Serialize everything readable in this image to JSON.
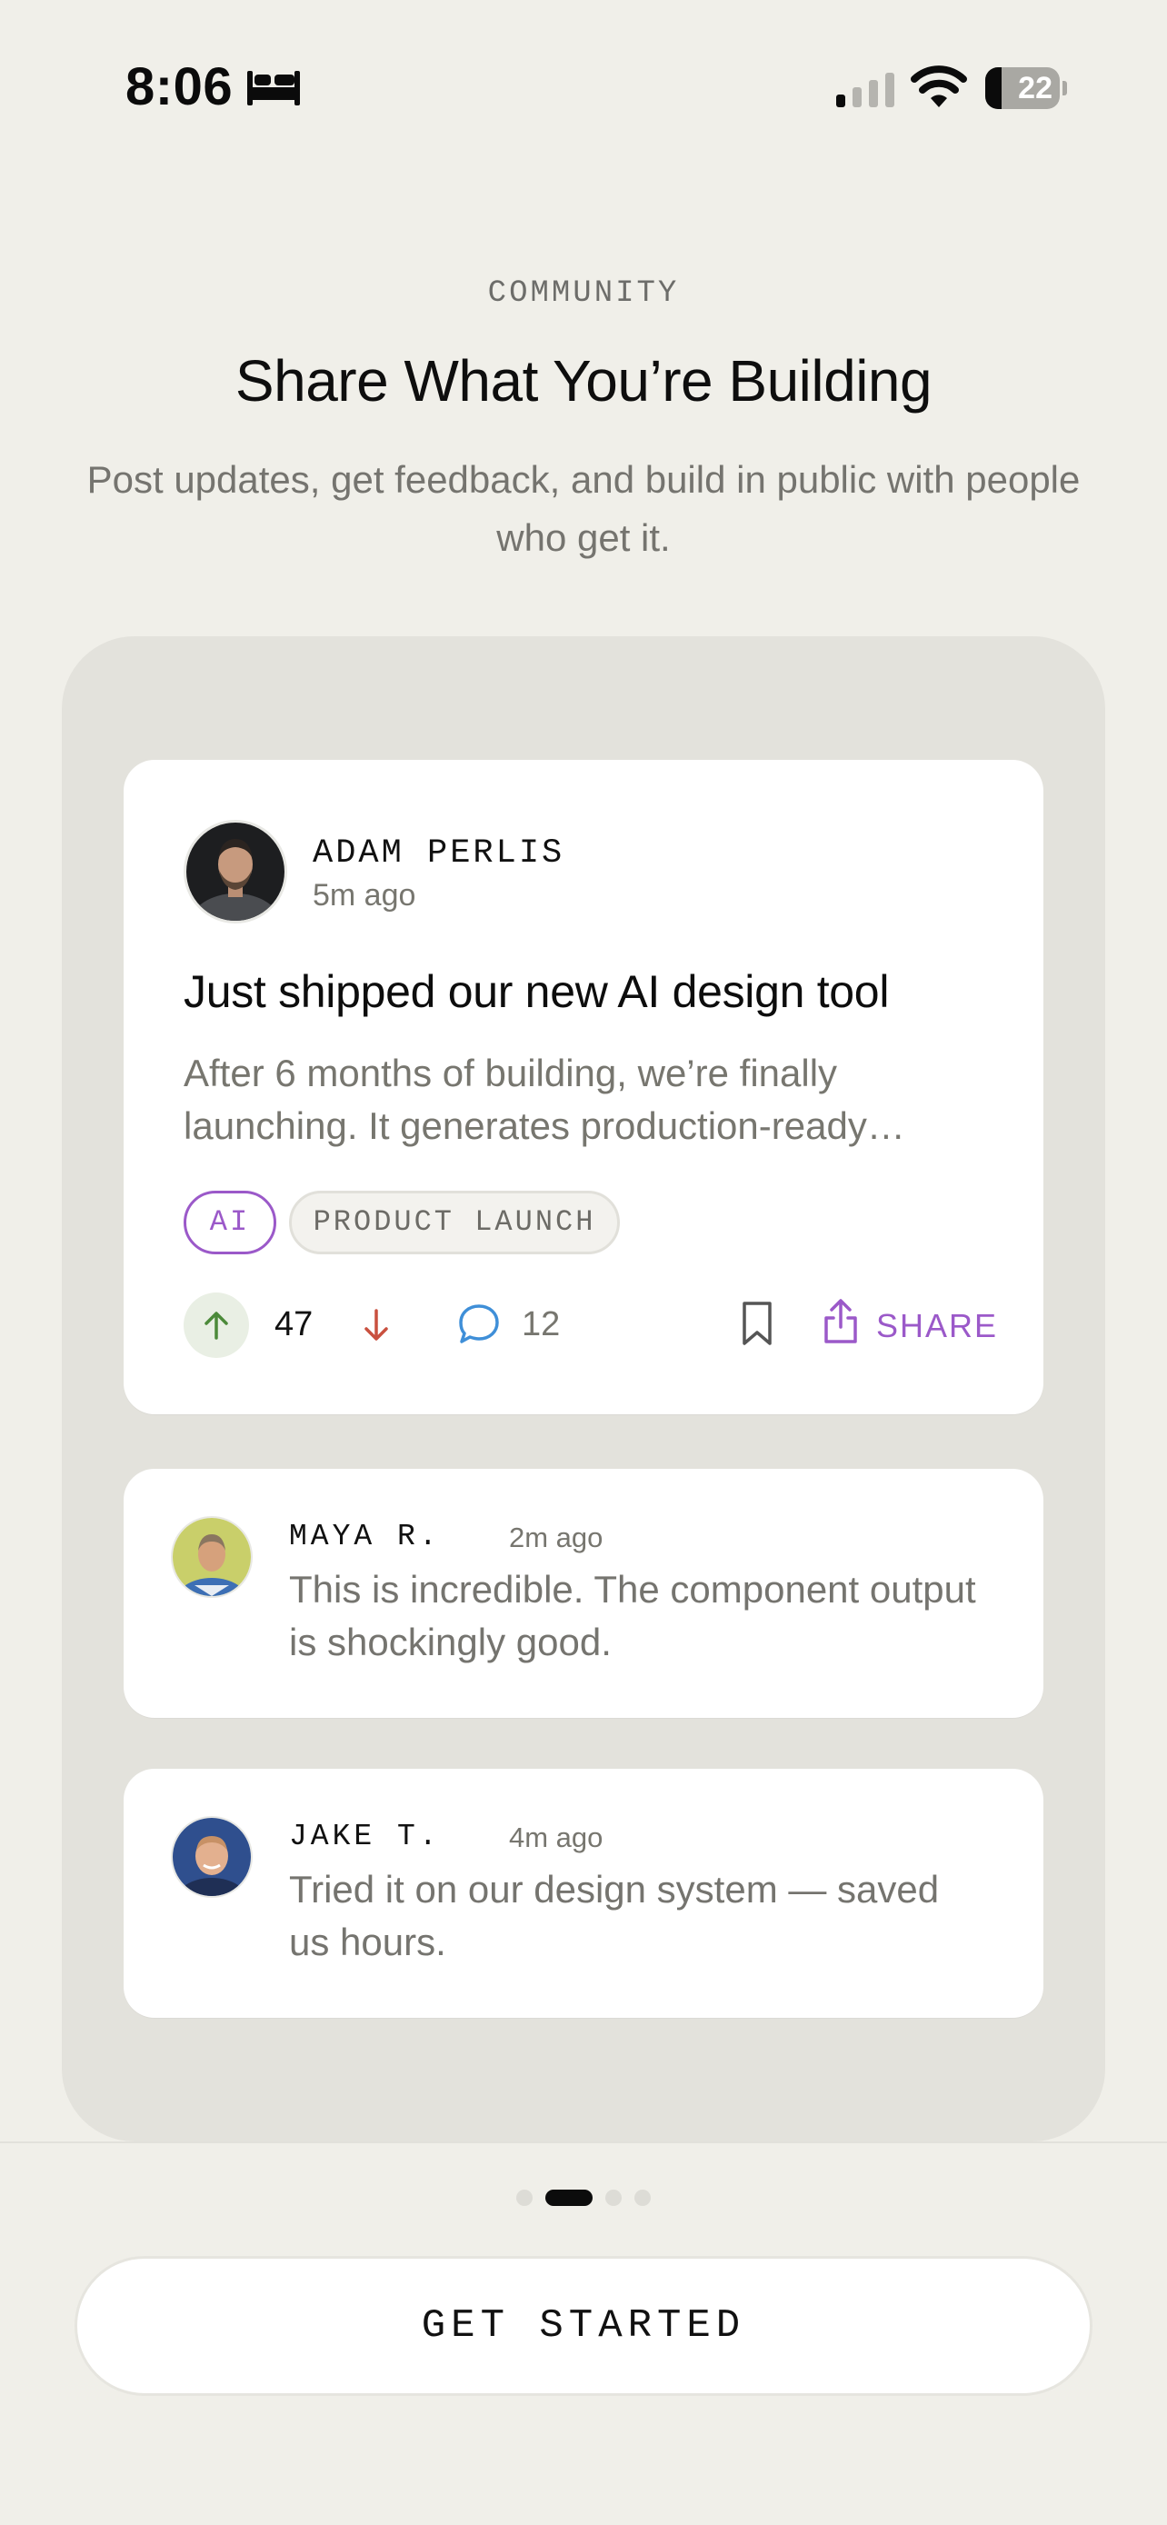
{
  "status_bar": {
    "time": "8:06",
    "battery_level": "22",
    "battery_fraction": 0.22,
    "icons": [
      "bed-icon",
      "signal-icon",
      "wifi-icon",
      "battery-icon"
    ]
  },
  "header": {
    "eyebrow": "COMMUNITY",
    "title": "Share What You’re Building",
    "subtitle": "Post updates, get feedback, and build in public with people who get it."
  },
  "post": {
    "author": "ADAM PERLIS",
    "time": "5m ago",
    "title": "Just shipped our new AI design tool",
    "body": "After 6 months of building, we’re finally launching. It generates production-ready…",
    "tags": [
      "AI",
      "PRODUCT LAUNCH"
    ],
    "score": "47",
    "comments": "12",
    "share_label": "SHARE",
    "icons": [
      "upvote-icon",
      "downvote-icon",
      "comment-icon",
      "bookmark-icon",
      "share-icon"
    ]
  },
  "comments": [
    {
      "author": "MAYA R.",
      "time": "2m ago",
      "text": "This is incredible. The component output is shockingly good."
    },
    {
      "author": "JAKE T.",
      "time": "4m ago",
      "text": "Tried it on our design system — saved us hours."
    }
  ],
  "pager": {
    "pages": 4,
    "current": 2
  },
  "cta": {
    "label": "GET STARTED"
  },
  "colors": {
    "accent": "#9b59c9",
    "upvote": "#4c8a3a",
    "downvote": "#c9503f",
    "comment": "#3f8fd8",
    "background": "#f0efe9",
    "panel": "#e3e2dc"
  }
}
